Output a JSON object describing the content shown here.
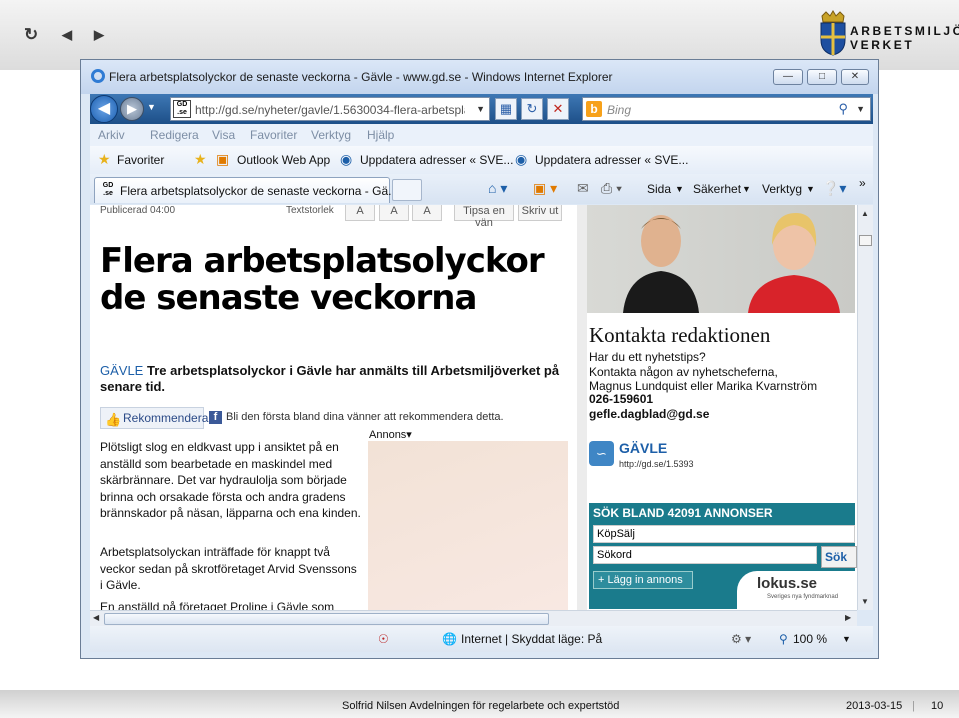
{
  "slide_nav": {
    "refresh": "↻",
    "back": "◀",
    "forward": "▶"
  },
  "logo": {
    "line1": "ARBETSMILJÖ",
    "line2": "VERKET"
  },
  "browser": {
    "title": "Flera arbetsplatsolyckor de senaste veckorna - Gävle - www.gd.se - Windows Internet Explorer",
    "url": "http://gd.se/nyheter/gavle/1.5630034-flera-arbetspla",
    "favicon": "GD .se",
    "search_placeholder": "Bing",
    "menu": [
      "Arkiv",
      "Redigera",
      "Visa",
      "Favoriter",
      "Verktyg",
      "Hjälp"
    ],
    "favorites": {
      "label": "Favoriter",
      "items": [
        "Outlook Web App",
        "Uppdatera adresser « SVE...",
        "Uppdatera adresser « SVE..."
      ]
    },
    "tab_title": "Flera arbetsplatsolyckor de senaste veckorna - Gä...",
    "commands": {
      "page": "Sida",
      "security": "Säkerhet",
      "tools": "Verktyg"
    },
    "status": {
      "zone": "Internet | Skyddat läge: På",
      "zoom": "100 %"
    }
  },
  "article": {
    "published": "Publicerad 04:00",
    "textsize_label": "Textstorlek",
    "font_buttons": [
      "A",
      "A",
      "A"
    ],
    "tipsa": "Tipsa en vän",
    "print": "Skriv ut",
    "headline": "Flera arbetsplatsolyckor de senaste veckorna",
    "city": "GÄVLE",
    "lead": "Tre arbetsplatsolyckor i Gävle har anmälts till Arbetsmiljöverket på senare tid.",
    "recommend": "Rekommendera",
    "fb_text": "Bli den första bland dina vänner att rekommendera detta.",
    "ad_label": "Annons▾",
    "paragraph1": "Plötsligt slog en eldkvast upp i ansiktet på en anställd som bearbetade en maskindel med skärbrännare. Det var hydraulolja som började brinna och orsakade första och andra gradens brännskador på näsan, läpparna och ena kinden.",
    "paragraph2": "Arbetsplatsolyckan inträffade för knappt två veckor sedan på skrotföretaget Arvid Svenssons i Gävle.",
    "paragraph3": "En anställd på företaget Proline i Gävle som"
  },
  "sidebar": {
    "contact_title": "Kontakta redaktionen",
    "contact_text": [
      "Har du ett nyhetstips?",
      "Kontakta någon av nyhetscheferna,",
      "Magnus Lundquist eller Marika Kvarnström"
    ],
    "phone": "026-159601",
    "email": "gefle.dagblad@gd.se",
    "rss_title": "GÄVLE",
    "rss_url": "http://gd.se/1.5393",
    "search_header": "SÖK BLAND 42091 ANNONSER",
    "select_value": "KöpSälj",
    "search_value": "Sökord",
    "search_button": "Sök",
    "add_button": "+ Lägg in annons",
    "lokus": "lokus.se",
    "lokus_sub": "Sveriges nya fyndmarknad"
  },
  "footer": {
    "presenter": "Solfrid Nilsen Avdelningen för regelarbete och expertstöd",
    "date": "2013-03-15",
    "page": "10"
  }
}
